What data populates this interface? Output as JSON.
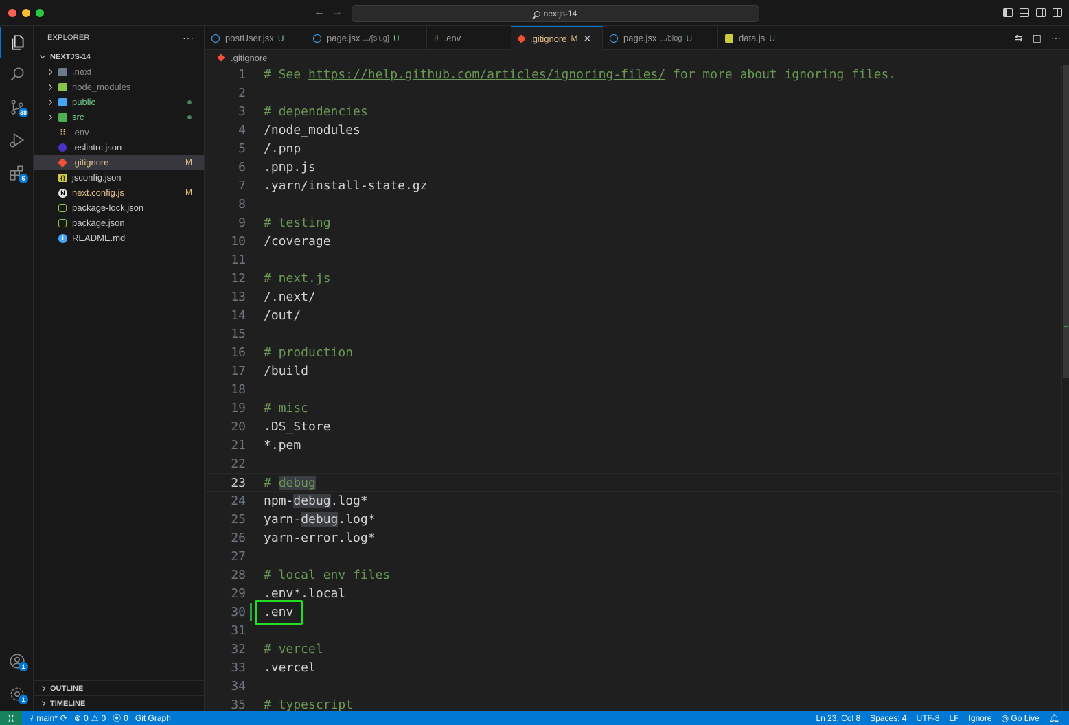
{
  "titlebar": {
    "search_text": "nextjs-14"
  },
  "activity": {
    "scm_badge": "38",
    "extensions_badge": "6",
    "accounts_badge": "1",
    "settings_badge": "1"
  },
  "sidebar": {
    "title": "EXPLORER",
    "more": "···",
    "project": "NEXTJS-14",
    "items": [
      {
        "label": ".next",
        "status": ""
      },
      {
        "label": "node_modules",
        "status": ""
      },
      {
        "label": "public",
        "status": ""
      },
      {
        "label": "src",
        "status": ""
      },
      {
        "label": ".env",
        "status": ""
      },
      {
        "label": ".eslintrc.json",
        "status": ""
      },
      {
        "label": ".gitignore",
        "status": "M"
      },
      {
        "label": "jsconfig.json",
        "status": ""
      },
      {
        "label": "next.config.js",
        "status": "M"
      },
      {
        "label": "package-lock.json",
        "status": ""
      },
      {
        "label": "package.json",
        "status": ""
      },
      {
        "label": "README.md",
        "status": ""
      }
    ],
    "outline": "OUTLINE",
    "timeline": "TIMELINE"
  },
  "tabs": [
    {
      "name": "postUser.jsx",
      "desc": "",
      "status": "U"
    },
    {
      "name": "page.jsx",
      "desc": ".../[slug]",
      "status": "U"
    },
    {
      "name": ".env",
      "desc": "",
      "status": ""
    },
    {
      "name": ".gitignore",
      "desc": "",
      "status": "M"
    },
    {
      "name": "page.jsx",
      "desc": ".../blog",
      "status": "U"
    },
    {
      "name": "data.js",
      "desc": "",
      "status": "U"
    }
  ],
  "breadcrumb": ".gitignore",
  "editor": {
    "lines": [
      {
        "n": "1",
        "parts": [
          {
            "t": "# See ",
            "c": "comment"
          },
          {
            "t": "https://help.github.com/articles/ignoring-files/",
            "c": "comment link"
          },
          {
            "t": " for more about ignoring files.",
            "c": "comment"
          }
        ]
      },
      {
        "n": "2",
        "parts": []
      },
      {
        "n": "3",
        "parts": [
          {
            "t": "# dependencies",
            "c": "comment"
          }
        ]
      },
      {
        "n": "4",
        "parts": [
          {
            "t": "/node_modules",
            "c": ""
          }
        ]
      },
      {
        "n": "5",
        "parts": [
          {
            "t": "/.pnp",
            "c": ""
          }
        ]
      },
      {
        "n": "6",
        "parts": [
          {
            "t": ".pnp.js",
            "c": ""
          }
        ]
      },
      {
        "n": "7",
        "parts": [
          {
            "t": ".yarn/install-state.gz",
            "c": ""
          }
        ]
      },
      {
        "n": "8",
        "parts": []
      },
      {
        "n": "9",
        "parts": [
          {
            "t": "# testing",
            "c": "comment"
          }
        ]
      },
      {
        "n": "10",
        "parts": [
          {
            "t": "/coverage",
            "c": ""
          }
        ]
      },
      {
        "n": "11",
        "parts": []
      },
      {
        "n": "12",
        "parts": [
          {
            "t": "# next.js",
            "c": "comment"
          }
        ]
      },
      {
        "n": "13",
        "parts": [
          {
            "t": "/.next/",
            "c": ""
          }
        ]
      },
      {
        "n": "14",
        "parts": [
          {
            "t": "/out/",
            "c": ""
          }
        ]
      },
      {
        "n": "15",
        "parts": []
      },
      {
        "n": "16",
        "parts": [
          {
            "t": "# production",
            "c": "comment"
          }
        ]
      },
      {
        "n": "17",
        "parts": [
          {
            "t": "/build",
            "c": ""
          }
        ]
      },
      {
        "n": "18",
        "parts": []
      },
      {
        "n": "19",
        "parts": [
          {
            "t": "# misc",
            "c": "comment"
          }
        ]
      },
      {
        "n": "20",
        "parts": [
          {
            "t": ".DS_Store",
            "c": ""
          }
        ]
      },
      {
        "n": "21",
        "parts": [
          {
            "t": "*.pem",
            "c": ""
          }
        ]
      },
      {
        "n": "22",
        "parts": []
      },
      {
        "n": "23",
        "parts": [
          {
            "t": "# ",
            "c": "comment"
          },
          {
            "t": "debug",
            "c": "comment hl"
          }
        ]
      },
      {
        "n": "24",
        "parts": [
          {
            "t": "npm-",
            "c": ""
          },
          {
            "t": "debug",
            "c": "hl"
          },
          {
            "t": ".log*",
            "c": ""
          }
        ]
      },
      {
        "n": "25",
        "parts": [
          {
            "t": "yarn-",
            "c": ""
          },
          {
            "t": "debug",
            "c": "hl"
          },
          {
            "t": ".log*",
            "c": ""
          }
        ]
      },
      {
        "n": "26",
        "parts": [
          {
            "t": "yarn-error.log*",
            "c": ""
          }
        ]
      },
      {
        "n": "27",
        "parts": []
      },
      {
        "n": "28",
        "parts": [
          {
            "t": "# local env files",
            "c": "comment"
          }
        ]
      },
      {
        "n": "29",
        "parts": [
          {
            "t": ".env*.local",
            "c": ""
          }
        ]
      },
      {
        "n": "30",
        "parts": [
          {
            "t": ".env",
            "c": ""
          }
        ]
      },
      {
        "n": "31",
        "parts": []
      },
      {
        "n": "32",
        "parts": [
          {
            "t": "# vercel",
            "c": "comment"
          }
        ]
      },
      {
        "n": "33",
        "parts": [
          {
            "t": ".vercel",
            "c": ""
          }
        ]
      },
      {
        "n": "34",
        "parts": []
      },
      {
        "n": "35",
        "parts": [
          {
            "t": "# typescript",
            "c": "comment"
          }
        ]
      }
    ]
  },
  "statusbar": {
    "branch": "main*",
    "errors": "0",
    "warnings": "0",
    "ports": "0",
    "git_graph": "Git Graph",
    "position": "Ln 23, Col 8",
    "spaces": "Spaces: 4",
    "encoding": "UTF-8",
    "eol": "LF",
    "language": "Ignore",
    "golive": "Go Live"
  }
}
